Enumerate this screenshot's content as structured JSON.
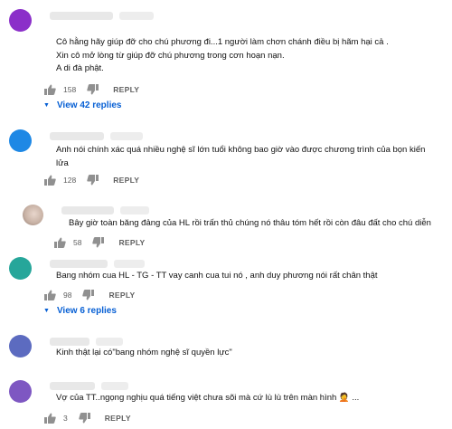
{
  "comments": [
    {
      "text": "Cô hằng hãy giúp đỡ cho chú phương đi...1 người làm chơn chánh điều bị hãm hại cả .\nXin cô mở lòng từ giúp đỡ chú phương trong cơn hoạn nạn.\nA di đà phật.",
      "likes": "158",
      "reply": "REPLY",
      "view_replies": "View 42 replies",
      "avatar_color": "#8b2fc9"
    },
    {
      "text": "Anh nói chính xác quá nhiều nghệ sĩ lớn tuổi không bao giờ vào được chương trình của bọn kiến\nlửa",
      "likes": "128",
      "reply": "REPLY",
      "avatar_color": "#1e88e5"
    },
    {
      "text": "Bây giờ toàn băng đảng của HL rồi trấn thủ chúng nó thâu tóm hết rồi còn đâu đất cho chú diễn",
      "likes": "58",
      "reply": "REPLY",
      "avatar_color": "#c9b3a6"
    },
    {
      "text": "Bang nhóm cua HL - TG - TT vay canh cua tui nó , anh duy phương nói rất chân thật",
      "likes": "98",
      "reply": "REPLY",
      "view_replies": "View 6 replies",
      "avatar_color": "#26a69a"
    },
    {
      "text": "Kinh thật lại có\"bang nhóm nghệ sĩ quyền lực\"",
      "avatar_color": "#5c6bc0"
    },
    {
      "text": "Vợ của TT..ngọng nghịu quá tiếng việt chưa sõi mà cứ lù lù trên màn hình 🤦 ...",
      "likes": "3",
      "reply": "REPLY",
      "avatar_color": "#7e57c2"
    }
  ]
}
